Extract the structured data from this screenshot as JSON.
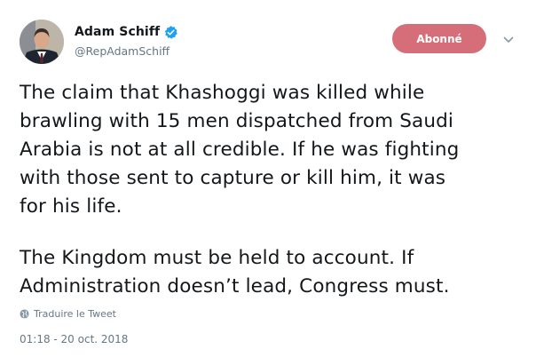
{
  "author": {
    "display_name": "Adam Schiff",
    "handle": "@RepAdamSchiff",
    "verified": true
  },
  "actions": {
    "follow_label": "Abonné",
    "follow_color": "#d66e79"
  },
  "tweet": {
    "lines_p1": [
      "The claim that Khashoggi was killed while",
      "brawling with 15 men dispatched from Saudi",
      "Arabia is not at all credible. If he was fighting",
      "with those sent to capture or kill him, it was",
      "for his life."
    ],
    "lines_p2": [
      "The Kingdom must be held to account. If",
      "Administration doesn’t lead, Congress must."
    ],
    "translate_label": "Traduire le Tweet",
    "timestamp": "01:18 - 20 oct. 2018"
  },
  "icons": {
    "verified": "verified-badge-icon",
    "caret": "chevron-down-icon",
    "translate": "globe-icon"
  },
  "colors": {
    "text": "#14171a",
    "muted": "#657786",
    "verified": "#1da1f2"
  }
}
